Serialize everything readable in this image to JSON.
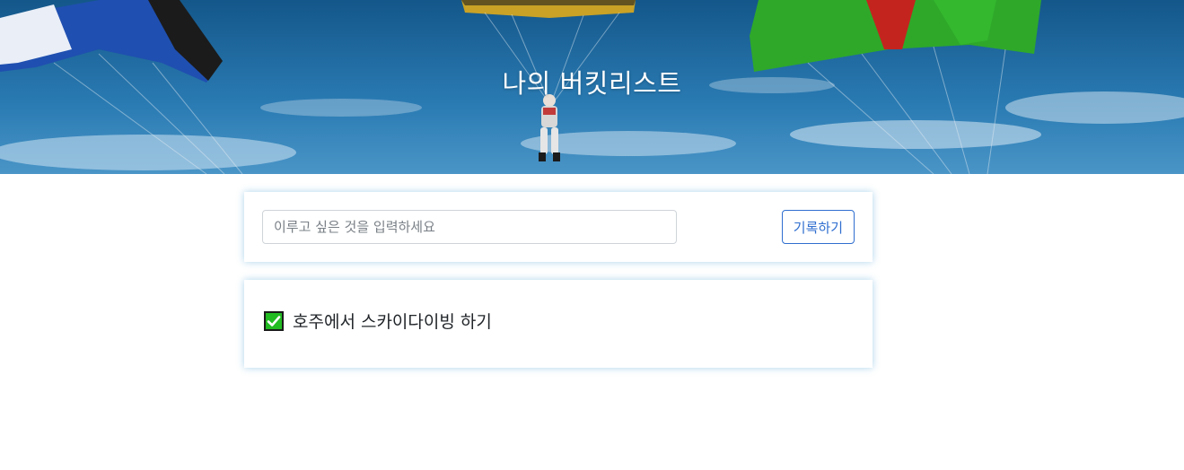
{
  "header": {
    "title": "나의 버킷리스트"
  },
  "form": {
    "input_value": "",
    "input_placeholder": "이루고 싶은 것을 입력하세요",
    "save_label": "기록하기"
  },
  "bucket_list": {
    "items": [
      {
        "text": "호주에서 스카이다이빙 하기",
        "done": true,
        "icon": "check-mark-icon"
      }
    ]
  },
  "colors": {
    "primary": "#2f6ecf",
    "sky": "#2476ae",
    "check_green": "#22bb22"
  }
}
